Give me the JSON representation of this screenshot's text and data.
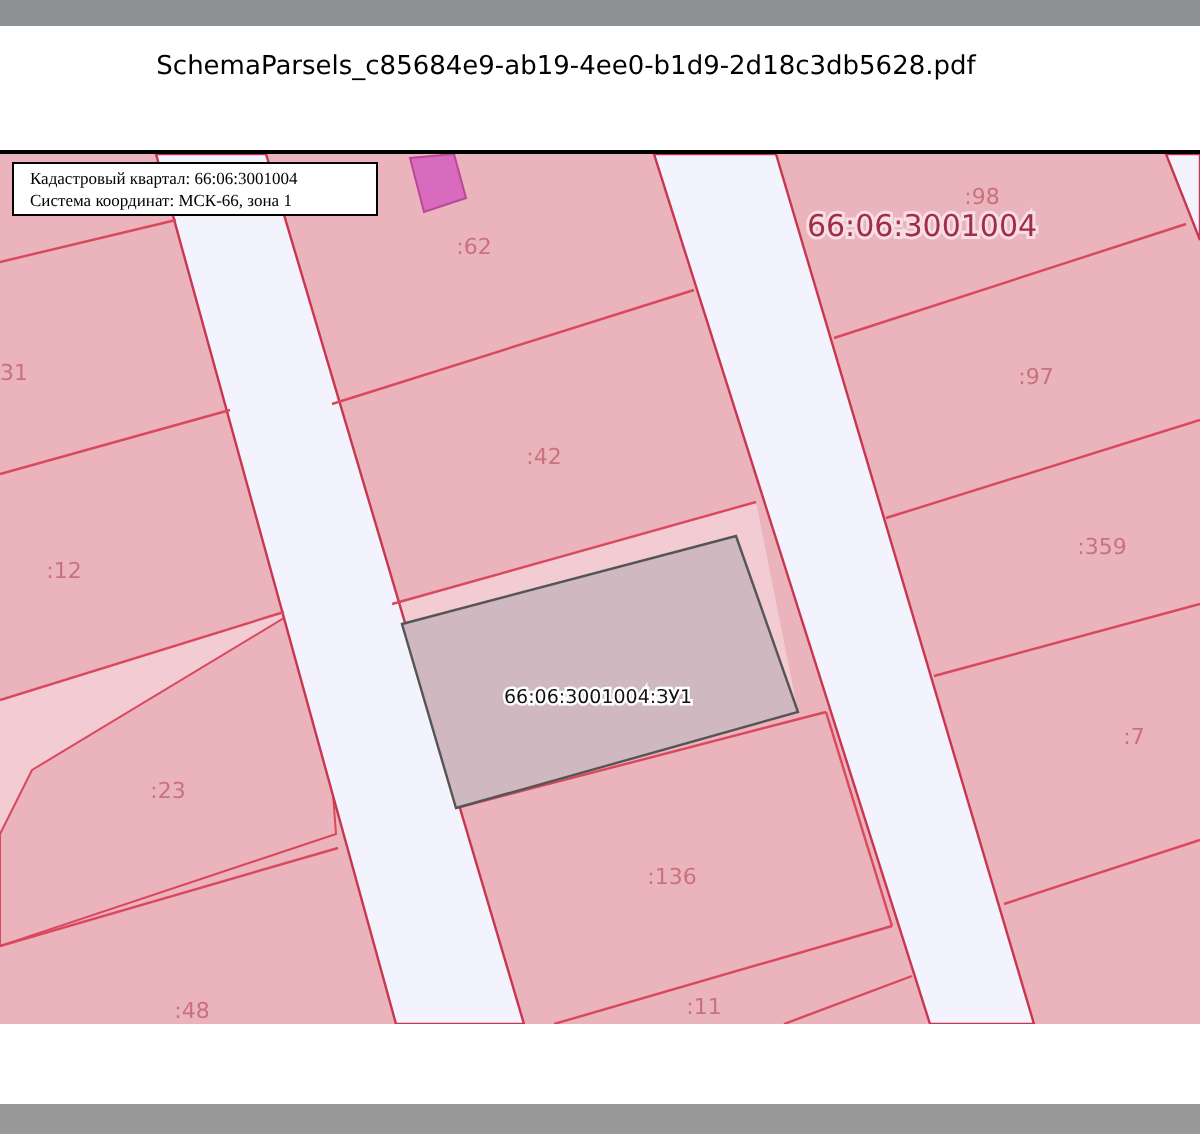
{
  "document": {
    "title": "SchemaParsels_c85684e9-ab19-4ee0-b1d9-2d18c3db5628.pdf"
  },
  "map": {
    "legend": [
      "Кадастровый квартал: 66:06:3001004",
      "Система координат: МСК-66, зона 1"
    ],
    "quarter_label": "66:06:3001004",
    "selected_parcel": "66:06:3001004:ЗУ1",
    "parcel_labels": [
      ":98",
      ":62",
      "31",
      ":42",
      ":97",
      ":12",
      ":359",
      ":7",
      ":23",
      ":136",
      ":48",
      ":11"
    ]
  }
}
